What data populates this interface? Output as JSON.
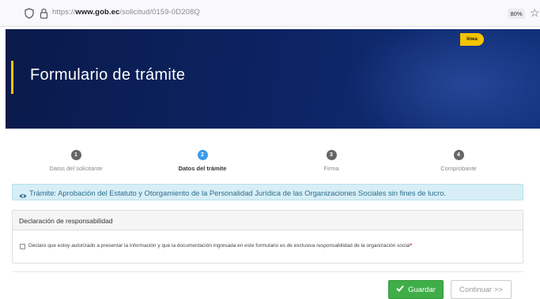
{
  "browser": {
    "url_prefix": "https://",
    "url_domain": "www.gob.ec",
    "url_path": "/solicitud/0159-0D208Q",
    "zoom": "80%",
    "icons": [
      "shield-icon",
      "lock-icon",
      "bookmark-star-icon"
    ]
  },
  "hero": {
    "title": "Formulario de trámite",
    "badge": "línea",
    "accent_color": "#f5c400",
    "background_color": "#0c2260"
  },
  "stepper": {
    "steps": [
      {
        "number": "1",
        "label": "Datos del solicitante",
        "active": false
      },
      {
        "number": "2",
        "label": "Datos del trámite",
        "active": true
      },
      {
        "number": "3",
        "label": "Firma",
        "active": false
      },
      {
        "number": "4",
        "label": "Comprobante",
        "active": false
      }
    ],
    "active_color": "#3d9be9"
  },
  "info": {
    "icon": "eye-icon",
    "text": "Trámite: Aprobación del Estatuto y Otorgamiento de la Personalidad Jurídica de las Organizaciones Sociales sin fines de lucro."
  },
  "declaration": {
    "title": "Declaración de responsabilidad",
    "checkbox_text": "Declaro que estoy autorizado a presentar la información y que la documentación ingresada en este formulario es de exclusiva responsabilidad de la organización social",
    "required_mark": "*",
    "checked": false
  },
  "actions": {
    "save_label": "Guardar",
    "save_icon": "check-icon",
    "next_label": "Continuar >>",
    "save_color": "#3fae49"
  }
}
